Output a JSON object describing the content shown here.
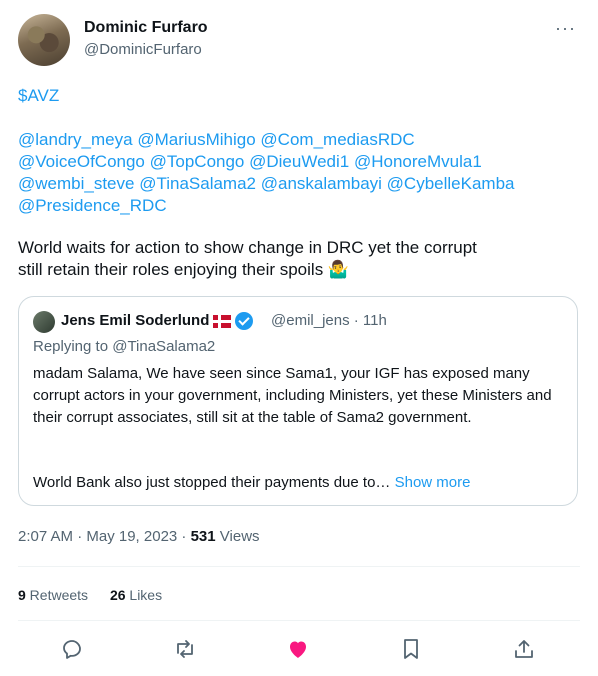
{
  "author": {
    "name": "Dominic Furfaro",
    "handle": "@DominicFurfaro"
  },
  "menu": {
    "more_icon": "···"
  },
  "tweet": {
    "cashtag": "$AVZ",
    "mentions": [
      "@landry_meya",
      "@MariusMihigo",
      "@Com_mediasRDC",
      "@VoiceOfCongo",
      "@TopCongo",
      "@DieuWedi1",
      "@HonoreMvula1",
      "@wembi_steve",
      "@TinaSalama2",
      "@anskalambayi",
      "@CybelleKamba",
      "@Presidence_RDC"
    ],
    "text_line1": "World waits for action to show change in DRC yet the corrupt",
    "text_line2": "still retain their roles enjoying their spoils 🤷‍♂️"
  },
  "quote": {
    "name": "Jens Emil Soderlund",
    "handle_time": "@emil_jens · 11h",
    "replying_to": "Replying to @TinaSalama2",
    "text": "madam Salama, We have seen since Sama1, your IGF has exposed many corrupt actors in your government, including Ministers, yet these Ministers and their corrupt associates, still sit at the table of Sama2 government.",
    "text2": "World Bank also just stopped their payments due to…",
    "show_more": "Show more"
  },
  "meta": {
    "time": "2:07 AM · May 19, 2023 · ",
    "views_count": "531",
    "views_label": " Views"
  },
  "stats": {
    "retweets_count": "9",
    "retweets_label": " Retweets",
    "likes_count": "26",
    "likes_label": " Likes"
  },
  "colors": {
    "link": "#1d9bf0",
    "like": "#f91880",
    "muted": "#536471"
  }
}
